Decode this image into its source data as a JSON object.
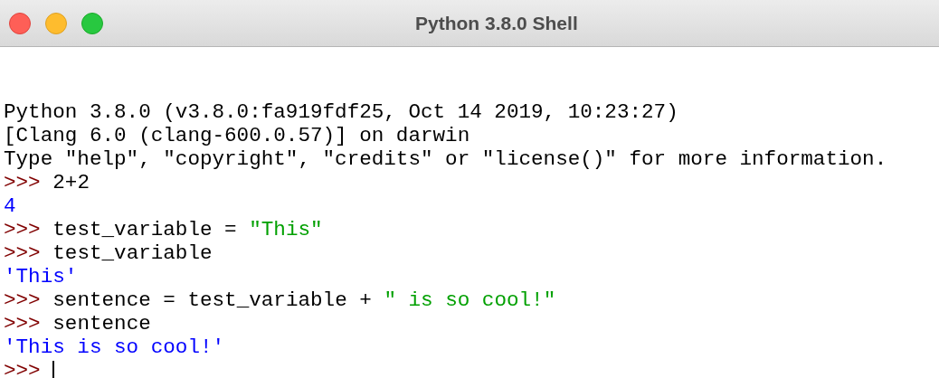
{
  "window": {
    "title": "Python 3.8.0 Shell"
  },
  "lines": [
    {
      "segments": [
        {
          "kind": "output",
          "text": "Python 3.8.0 (v3.8.0:fa919fdf25, Oct 14 2019, 10:23:27)"
        }
      ]
    },
    {
      "segments": [
        {
          "kind": "output",
          "text": "[Clang 6.0 (clang-600.0.57)] on darwin"
        }
      ]
    },
    {
      "segments": [
        {
          "kind": "output",
          "text": "Type \"help\", \"copyright\", \"credits\" or \"license()\" for more information."
        }
      ]
    },
    {
      "segments": [
        {
          "kind": "prompt",
          "text": ">>>"
        },
        {
          "kind": "code",
          "text": "2+2"
        }
      ]
    },
    {
      "segments": [
        {
          "kind": "result",
          "text": "4"
        }
      ]
    },
    {
      "segments": [
        {
          "kind": "prompt",
          "text": ">>>"
        },
        {
          "kind": "code",
          "text": "test_variable = "
        },
        {
          "kind": "string",
          "text": "\"This\""
        }
      ]
    },
    {
      "segments": [
        {
          "kind": "prompt",
          "text": ">>>"
        },
        {
          "kind": "code",
          "text": "test_variable"
        }
      ]
    },
    {
      "segments": [
        {
          "kind": "result",
          "text": "'This'"
        }
      ]
    },
    {
      "segments": [
        {
          "kind": "prompt",
          "text": ">>>"
        },
        {
          "kind": "code",
          "text": "sentence = test_variable + "
        },
        {
          "kind": "string",
          "text": "\" is so cool!\""
        }
      ]
    },
    {
      "segments": [
        {
          "kind": "prompt",
          "text": ">>>"
        },
        {
          "kind": "code",
          "text": "sentence"
        }
      ]
    },
    {
      "segments": [
        {
          "kind": "result",
          "text": "'This is so cool!'"
        }
      ]
    },
    {
      "segments": [
        {
          "kind": "prompt",
          "text": ">>>"
        }
      ],
      "cursor": true
    }
  ]
}
